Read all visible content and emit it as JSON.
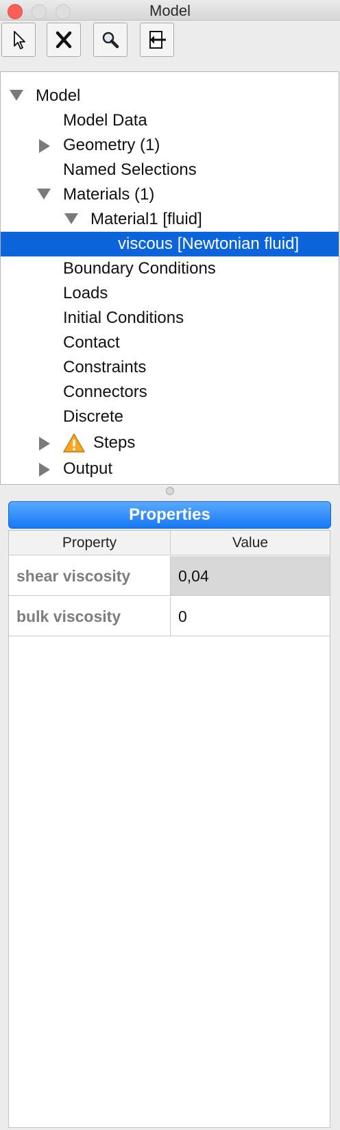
{
  "window": {
    "title": "Model"
  },
  "toolbar": {
    "buttons": [
      {
        "name": "select-tool",
        "icon": "pointer-icon"
      },
      {
        "name": "delete-tool",
        "icon": "x-icon"
      },
      {
        "name": "zoom-tool",
        "icon": "magnifier-icon"
      },
      {
        "name": "exit-tool",
        "icon": "exit-icon"
      }
    ]
  },
  "tree": {
    "items": [
      {
        "label": "Model",
        "expander": "expanded"
      },
      {
        "label": "Model Data"
      },
      {
        "label": "Geometry (1)",
        "expander": "collapsed"
      },
      {
        "label": "Named Selections"
      },
      {
        "label": "Materials (1)",
        "expander": "expanded"
      },
      {
        "label": "Material1 [fluid]",
        "expander": "expanded"
      },
      {
        "label": "viscous [Newtonian fluid]",
        "selected": true
      },
      {
        "label": "Boundary Conditions"
      },
      {
        "label": "Loads"
      },
      {
        "label": "Initial Conditions"
      },
      {
        "label": "Contact"
      },
      {
        "label": "Constraints"
      },
      {
        "label": "Connectors"
      },
      {
        "label": "Discrete"
      },
      {
        "label": "Steps",
        "expander": "collapsed",
        "icon": "warning-icon"
      },
      {
        "label": "Output",
        "expander": "collapsed"
      }
    ]
  },
  "properties": {
    "header": "Properties",
    "columns": [
      "Property",
      "Value"
    ],
    "rows": [
      {
        "property": "shear viscosity",
        "value": "0,04"
      },
      {
        "property": "bulk viscosity",
        "value": "0"
      }
    ]
  },
  "colors": {
    "selection": "#0b64d9",
    "header_accent": "#1678f5",
    "close_button": "#fd5f57"
  }
}
